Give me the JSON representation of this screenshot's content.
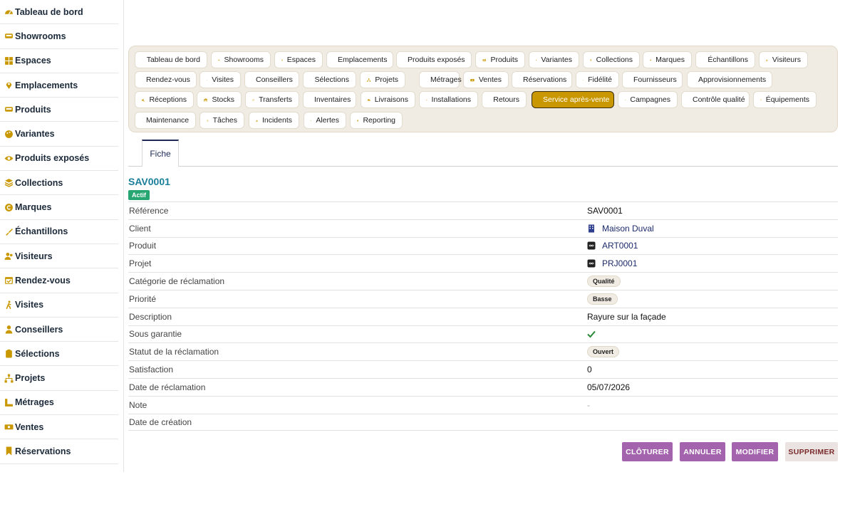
{
  "sidebar": {
    "items": [
      {
        "label": "Tableau de bord",
        "icon": "gauge-icon"
      },
      {
        "label": "Showrooms",
        "icon": "couch-icon"
      },
      {
        "label": "Espaces",
        "icon": "grid-icon"
      },
      {
        "label": "Emplacements",
        "icon": "map-pin-icon"
      },
      {
        "label": "Produits",
        "icon": "couch-icon"
      },
      {
        "label": "Variantes",
        "icon": "palette-icon"
      },
      {
        "label": "Produits exposés",
        "icon": "eye-icon"
      },
      {
        "label": "Collections",
        "icon": "layers-icon"
      },
      {
        "label": "Marques",
        "icon": "copyright-icon"
      },
      {
        "label": "Échantillons",
        "icon": "brush-icon"
      },
      {
        "label": "Visiteurs",
        "icon": "users-icon"
      },
      {
        "label": "Rendez-vous",
        "icon": "calendar-icon"
      },
      {
        "label": "Visites",
        "icon": "walking-icon"
      },
      {
        "label": "Conseillers",
        "icon": "user-tie-icon"
      },
      {
        "label": "Sélections",
        "icon": "clipboard-icon"
      },
      {
        "label": "Projets",
        "icon": "sitemap-icon"
      },
      {
        "label": "Métrages",
        "icon": "ruler-icon"
      },
      {
        "label": "Ventes",
        "icon": "cash-icon"
      },
      {
        "label": "Réservations",
        "icon": "bookmark-icon"
      }
    ]
  },
  "nav": {
    "chips": [
      {
        "label": "Tableau de bord",
        "icon": "gauge-icon"
      },
      {
        "label": "Showrooms",
        "icon": "couch-icon"
      },
      {
        "label": "Espaces",
        "icon": "grid-icon"
      },
      {
        "label": "Emplacements",
        "icon": "map-pin-icon"
      },
      {
        "label": "Produits exposés",
        "icon": "eye-icon"
      },
      {
        "label": "Produits",
        "icon": "couch-icon"
      },
      {
        "label": "Variantes",
        "icon": "palette-icon"
      },
      {
        "label": "Collections",
        "icon": "layers-icon"
      },
      {
        "label": "Marques",
        "icon": "copyright-icon"
      },
      {
        "label": "Échantillons",
        "icon": "brush-icon"
      },
      {
        "label": "Visiteurs",
        "icon": "users-icon"
      },
      {
        "label": "Rendez-vous",
        "icon": "calendar-icon"
      },
      {
        "label": "Visites",
        "icon": "walking-icon"
      },
      {
        "label": "Conseillers",
        "icon": "user-tie-icon"
      },
      {
        "label": "Sélections",
        "icon": "clipboard-icon"
      },
      {
        "label": "Projets",
        "icon": "sitemap-icon"
      },
      {
        "label": "Métrages",
        "icon": "ruler-icon"
      },
      {
        "label": "Ventes",
        "icon": "cash-icon"
      },
      {
        "label": "Réservations",
        "icon": "bookmark-icon"
      },
      {
        "label": "Fidélité",
        "icon": "award-icon"
      },
      {
        "label": "Fournisseurs",
        "icon": "industry-icon"
      },
      {
        "label": "Approvisionnements",
        "icon": "cart-icon"
      },
      {
        "label": "Réceptions",
        "icon": "truck-loading-icon"
      },
      {
        "label": "Stocks",
        "icon": "warehouse-icon"
      },
      {
        "label": "Transferts",
        "icon": "exchange-icon"
      },
      {
        "label": "Inventaires",
        "icon": "clipboard-check-icon"
      },
      {
        "label": "Livraisons",
        "icon": "truck-icon"
      },
      {
        "label": "Installations",
        "icon": "hard-hat-icon"
      },
      {
        "label": "Retours",
        "icon": "undo-icon"
      },
      {
        "label": "Service après-vente",
        "icon": "comment-icon",
        "active": true
      },
      {
        "label": "Campagnes",
        "icon": "bullhorn-icon"
      },
      {
        "label": "Contrôle qualité",
        "icon": "clipboard-list-icon"
      },
      {
        "label": "Équipements",
        "icon": "desktop-icon"
      },
      {
        "label": "Maintenance",
        "icon": "tools-icon"
      },
      {
        "label": "Tâches",
        "icon": "tasks-icon"
      },
      {
        "label": "Incidents",
        "icon": "warning-icon"
      },
      {
        "label": "Alertes",
        "icon": "bell-icon"
      },
      {
        "label": "Reporting",
        "icon": "pie-chart-icon"
      }
    ]
  },
  "tabs": {
    "fiche": "Fiche"
  },
  "record": {
    "title": "SAV0001",
    "status": "Actif",
    "fields": [
      {
        "key": "Référence",
        "value": "SAV0001",
        "kind": "text"
      },
      {
        "key": "Client",
        "value": "Maison Duval",
        "kind": "link",
        "icon": "building-icon"
      },
      {
        "key": "Produit",
        "value": "ART0001",
        "kind": "link",
        "icon": "infinity-icon"
      },
      {
        "key": "Projet",
        "value": "PRJ0001",
        "kind": "link",
        "icon": "infinity-icon"
      },
      {
        "key": "Catégorie de réclamation",
        "value": "Qualité",
        "kind": "pill"
      },
      {
        "key": "Priorité",
        "value": "Basse",
        "kind": "pill"
      },
      {
        "key": "Description",
        "value": "Rayure sur la façade",
        "kind": "text"
      },
      {
        "key": "Sous garantie",
        "value": "✔",
        "kind": "check"
      },
      {
        "key": "Statut de la réclamation",
        "value": "Ouvert",
        "kind": "pill"
      },
      {
        "key": "Satisfaction",
        "value": "0",
        "kind": "text"
      },
      {
        "key": "Date de réclamation",
        "value": "05/07/2026",
        "kind": "text"
      },
      {
        "key": "Note",
        "value": "-",
        "kind": "muted"
      },
      {
        "key": "Date de création",
        "value": "",
        "kind": "text"
      }
    ]
  },
  "actions": {
    "cloturer": "CLÔTURER",
    "annuler": "ANNULER",
    "modifier": "MODIFIER",
    "supprimer": "SUPPRIMER"
  },
  "colors": {
    "accent": "#c99700",
    "title": "#1a7f9a",
    "badge": "#28a672",
    "button": "#a463ad"
  }
}
